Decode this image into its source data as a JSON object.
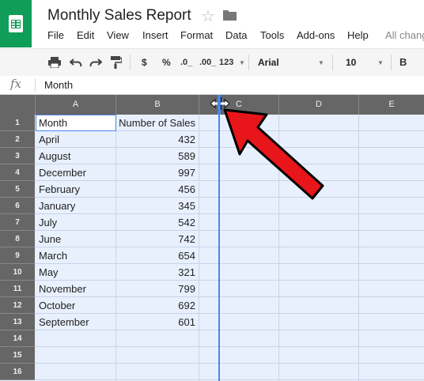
{
  "app": {
    "title": "Monthly Sales Report",
    "icons": {
      "logo": "sheets-logo-icon",
      "star": "star-icon",
      "folder": "folder-icon"
    }
  },
  "menu": [
    "File",
    "Edit",
    "View",
    "Insert",
    "Format",
    "Data",
    "Tools",
    "Add-ons",
    "Help"
  ],
  "status": "All chang",
  "toolbar": {
    "currency": "$",
    "percent": "%",
    "decrease_decimals": ".0_",
    "increase_decimals": ".00_",
    "more_formats": "123",
    "font": "Arial",
    "font_size": "10",
    "bold": "B"
  },
  "formula_bar": {
    "fx_label": "fx",
    "value": "Month"
  },
  "columns": [
    "A",
    "B",
    "C",
    "D",
    "E"
  ],
  "rows": [
    "1",
    "2",
    "3",
    "4",
    "5",
    "6",
    "7",
    "8",
    "9",
    "10",
    "11",
    "12",
    "13",
    "14",
    "15",
    "16"
  ],
  "sheet": {
    "header": [
      "Month",
      "Number of Sales"
    ],
    "data": [
      [
        "April",
        "432"
      ],
      [
        "August",
        "589"
      ],
      [
        "December",
        "997"
      ],
      [
        "February",
        "456"
      ],
      [
        "January",
        "345"
      ],
      [
        "July",
        "542"
      ],
      [
        "June",
        "742"
      ],
      [
        "March",
        "654"
      ],
      [
        "May",
        "321"
      ],
      [
        "November",
        "799"
      ],
      [
        "October",
        "692"
      ],
      [
        "September",
        "601"
      ]
    ]
  },
  "colors": {
    "sheets_green": "#0f9d58",
    "header_gray": "#666666",
    "selection_blue": "#e8f0fe",
    "resize_handle": "#4a86e8",
    "arrow_red": "#e8151b"
  }
}
